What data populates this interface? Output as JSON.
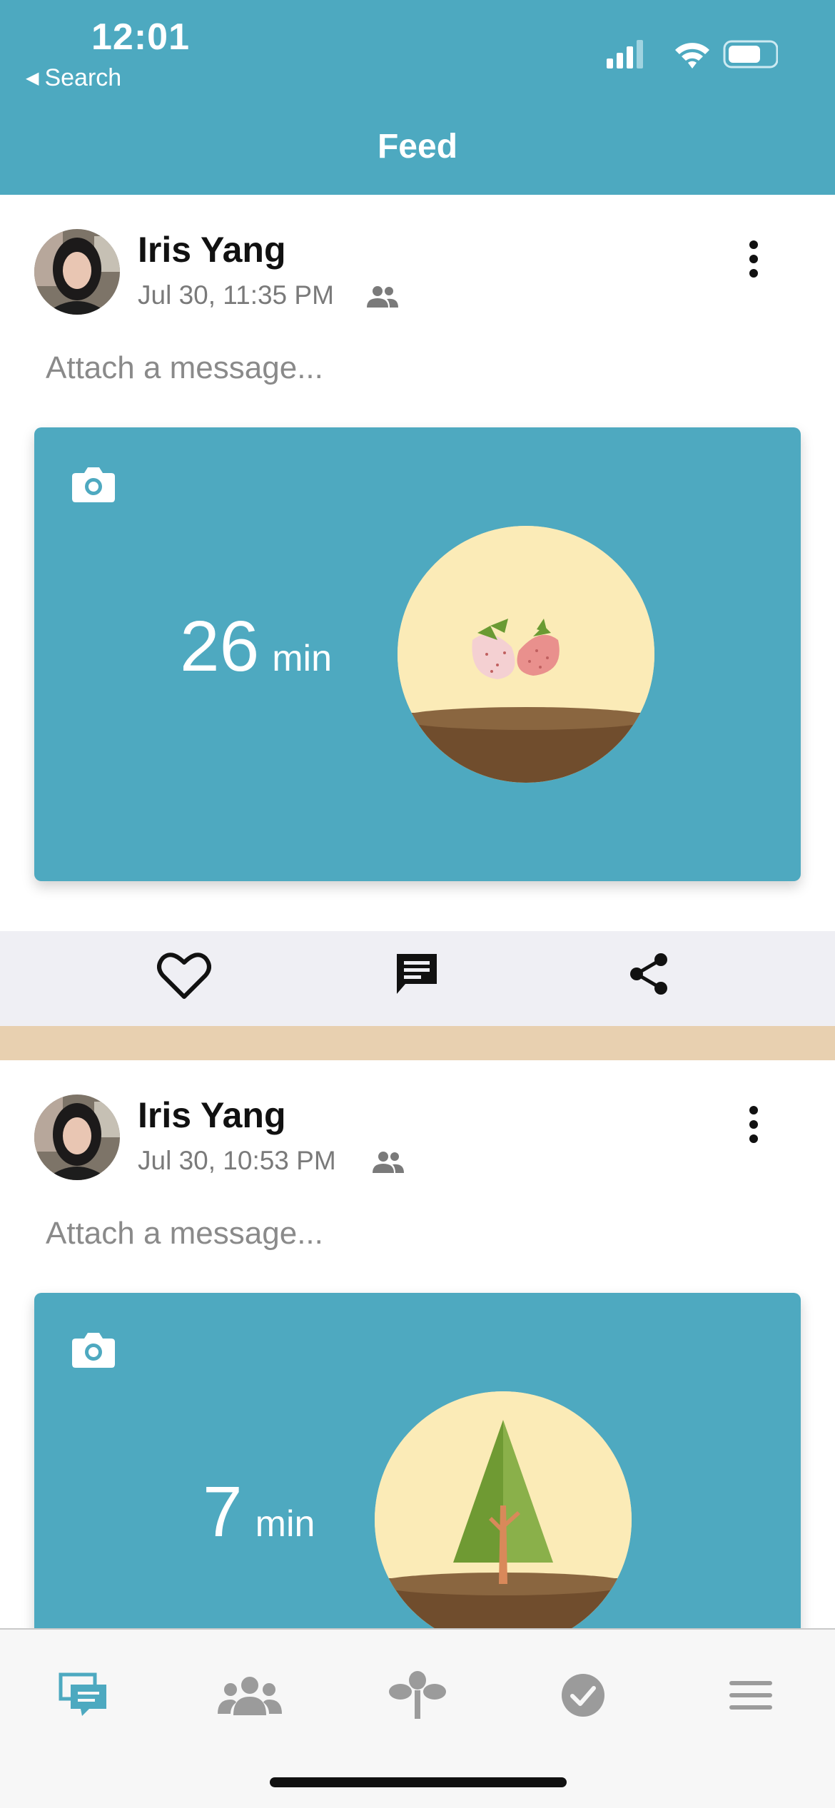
{
  "status_bar": {
    "time": "12:01",
    "back_label": "Search"
  },
  "header": {
    "title": "Feed"
  },
  "posts": [
    {
      "user_name": "Iris Yang",
      "timestamp": "Jul 30, 11:35 PM",
      "message_placeholder": "Attach a message...",
      "duration_value": "26",
      "duration_unit": "min",
      "plant": "strawberries"
    },
    {
      "user_name": "Iris Yang",
      "timestamp": "Jul 30, 10:53 PM",
      "message_placeholder": "Attach a message...",
      "duration_value": "7",
      "duration_unit": "min",
      "plant": "tree"
    }
  ],
  "actions": {
    "like_icon": "heart-icon",
    "comment_icon": "comment-icon",
    "share_icon": "share-icon"
  },
  "tabbar": {
    "items": [
      "feed-icon",
      "friends-icon",
      "plant-icon",
      "check-icon",
      "menu-icon"
    ],
    "active_color": "#4da9c0",
    "inactive_color": "#9b9b9b"
  },
  "colors": {
    "header": "#4da9c0",
    "card": "#4ea9c0",
    "band": "#e8d0b0"
  }
}
